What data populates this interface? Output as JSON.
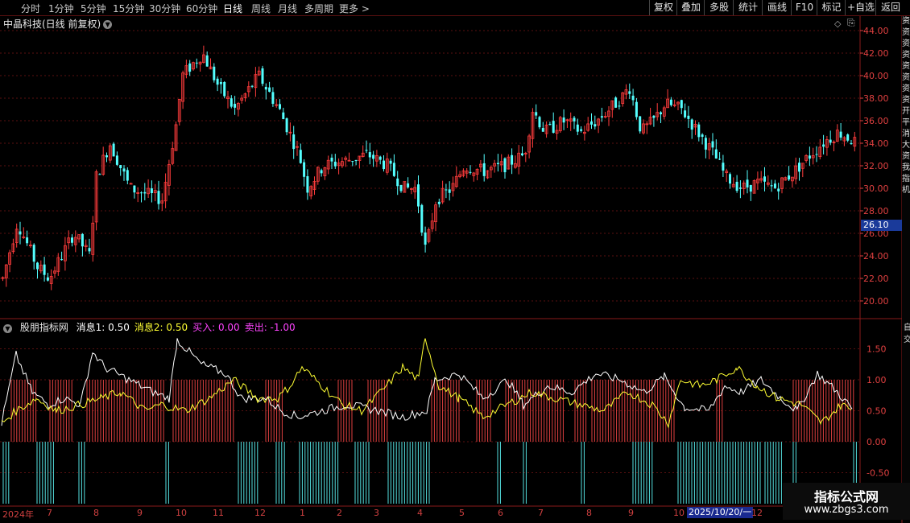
{
  "toolbar": {
    "periods": [
      "分时",
      "1分钟",
      "5分钟",
      "15分钟",
      "30分钟",
      "60分钟",
      "日线",
      "周线",
      "月线",
      "多周期",
      "更多 >"
    ],
    "active_period": "日线",
    "right_buttons": [
      "复权",
      "叠加",
      "多股",
      "统计",
      "画线",
      "F10",
      "标记",
      "+自选",
      "返回"
    ]
  },
  "main_chart": {
    "title": "中晶科技(日线 前复权)",
    "price_ticks": [
      "44.00",
      "42.00",
      "40.00",
      "38.00",
      "36.00",
      "34.00",
      "32.00",
      "30.00",
      "28.00",
      "26.00",
      "24.00",
      "22.00",
      "20.00"
    ],
    "current_price_tag": "26.10",
    "colors": {
      "up": "#ff3c3c",
      "down": "#54ffff",
      "grid": "#5a1010"
    }
  },
  "indicator": {
    "name": "股朋指标网",
    "items": [
      {
        "label": "消息1: 0.50",
        "color": "#ffffff"
      },
      {
        "label": "消息2: 0.50",
        "color": "#ffff33"
      },
      {
        "label": "买入: 0.00",
        "color": "#ff44ff"
      },
      {
        "label": "卖出: -1.00",
        "color": "#ff44ff"
      }
    ],
    "ticks": [
      "1.50",
      "1.00",
      "0.50",
      "0.00",
      "-0.50"
    ]
  },
  "date_axis": {
    "labels": [
      "2024年",
      "7",
      "8",
      "9",
      "10",
      "11",
      "12",
      "1",
      "2",
      "3",
      "4",
      "5",
      "6",
      "7",
      "8",
      "9",
      "10"
    ],
    "highlight": "2025/10/20/一",
    "after_highlight": "12"
  },
  "side_strip": [
    "资",
    "资",
    "资",
    "资",
    "资",
    "资",
    "资",
    "资",
    "开",
    "平",
    "消",
    "大",
    "资",
    "我",
    "指",
    "机"
  ],
  "side_strip2": [
    "自",
    "交"
  ],
  "watermark": {
    "line1": "指标公式网",
    "line2": "www.zbgs3.com"
  }
}
